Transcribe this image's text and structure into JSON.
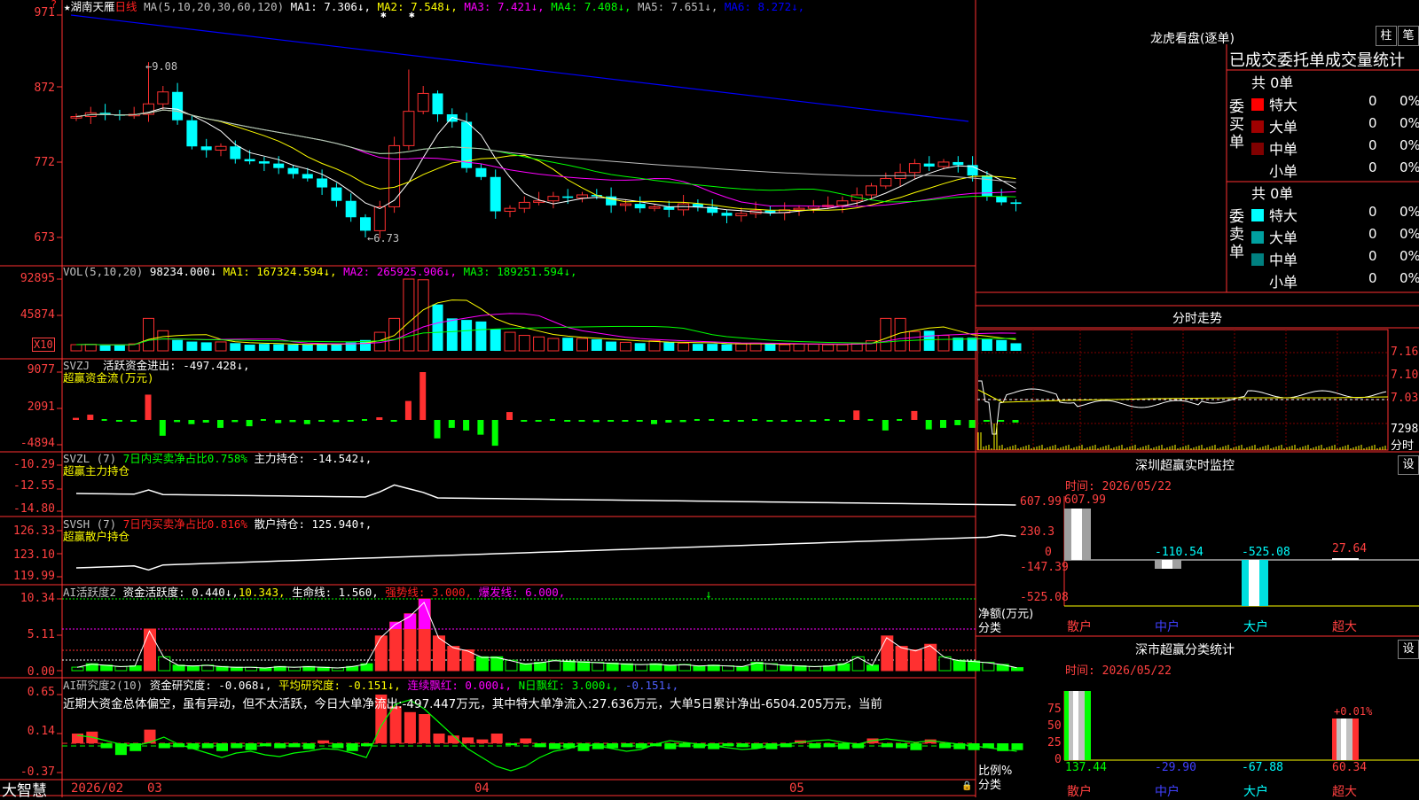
{
  "stock": {
    "name": "湖南天雁",
    "period": "日线",
    "star": "★"
  },
  "main_pane": {
    "ma_label": "MA(5,10,20,30,60,120)",
    "ma": [
      {
        "label": "MA1:",
        "value": "7.306↓",
        "color": "#ffffff"
      },
      {
        "label": "MA2:",
        "value": "7.548↓",
        "color": "#ffff00"
      },
      {
        "label": "MA3:",
        "value": "7.421↓",
        "color": "#ff00ff"
      },
      {
        "label": "MA4:",
        "value": "7.408↓",
        "color": "#00ff00"
      },
      {
        "label": "MA5:",
        "value": "7.651↓",
        "color": "#c0c0c0"
      },
      {
        "label": "MA6:",
        "value": "8.272↓",
        "color": "#0000ff"
      }
    ],
    "y_labels": [
      "971",
      "872",
      "772",
      "673"
    ],
    "high_mark": "9.08",
    "low_mark": "6.73"
  },
  "vol_pane": {
    "label": "VOL(5,10,20)",
    "value": "98234.000↓",
    "ma": [
      {
        "label": "MA1:",
        "value": "167324.594↓",
        "color": "#ffff00"
      },
      {
        "label": "MA2:",
        "value": "265925.906↓",
        "color": "#ff00ff"
      },
      {
        "label": "MA3:",
        "value": "189251.594↓",
        "color": "#00ff00"
      }
    ],
    "y_labels": [
      "92895",
      "45874"
    ],
    "unit": "X10"
  },
  "svzj_pane": {
    "label": "SVZJ",
    "field": "活跃资金进出:",
    "value": "-497.428↓,",
    "subtitle": "超赢资金流(万元)",
    "y_labels": [
      "9077",
      "2091",
      "-4894"
    ]
  },
  "svzl_pane": {
    "label": "SVZL (7)",
    "field1": "7日内买卖净占比0.758%",
    "field2": "主力持仓:",
    "value": "-14.542↓,",
    "subtitle": "超赢主力持仓",
    "y_labels": [
      "-10.29",
      "-12.55",
      "-14.80"
    ]
  },
  "svsh_pane": {
    "label": "SVSH (7)",
    "field1": "7日内买卖净占比0.816%",
    "field2": "散户持仓:",
    "value": "125.940↑,",
    "subtitle": "超赢散户持仓",
    "y_labels": [
      "126.33",
      "123.10",
      "119.99"
    ]
  },
  "active_pane": {
    "label": "AI活跃度2",
    "field1": "资金活跃度:",
    "value1": "0.440↓,",
    "value2": "10.343,",
    "field3": "生命线:",
    "value3": "1.560,",
    "field4": "强势线:",
    "value4": "3.000,",
    "field5": "爆发线:",
    "value5": "6.000,",
    "y_labels": [
      "10.34",
      "5.11",
      "0.00"
    ]
  },
  "research_pane": {
    "label": "AI研究度2(10)",
    "field1": "资金研究度:",
    "value1": "-0.068↓,",
    "field2": "平均研究度:",
    "value2": "-0.151↓,",
    "field3": "连续飘红:",
    "value3": "0.000↓,",
    "field4": "N日飘红:",
    "value4": "3.000↓,",
    "value5": "-0.151↓,",
    "comment": "近期大资金总体偏空，虽有异动，但不太活跃，今日大单净流出:-497.447万元，其中特大单净流入:27.636万元，大单5日累计净出-6504.205万元，当前",
    "y_labels": [
      "0.65",
      "0.14",
      "-0.37"
    ]
  },
  "x_axis": {
    "brand": "大智慧",
    "labels": [
      "2026/02",
      "03",
      "04",
      "05"
    ]
  },
  "dragon_tiger": {
    "title": "龙虎看盘(逐单)",
    "btn_bar": "柱",
    "btn_pen": "笔",
    "header": "已成交委托单成交量统计",
    "buy_side": {
      "side_label": "委买单",
      "total": "共 0单",
      "rows": [
        {
          "name": "特大",
          "count": "0",
          "pct": "0%",
          "color": "#ff0000"
        },
        {
          "name": "大单",
          "count": "0",
          "pct": "0%",
          "color": "#a00000"
        },
        {
          "name": "中单",
          "count": "0",
          "pct": "0%",
          "color": "#800000"
        },
        {
          "name": "小单",
          "count": "0",
          "pct": "0%",
          "color": ""
        }
      ]
    },
    "sell_side": {
      "side_label": "委卖单",
      "total": "共 0单",
      "rows": [
        {
          "name": "特大",
          "count": "0",
          "pct": "0%",
          "color": "#00ffff"
        },
        {
          "name": "大单",
          "count": "0",
          "pct": "0%",
          "color": "#00a0a0"
        },
        {
          "name": "中单",
          "count": "0",
          "pct": "0%",
          "color": "#008080"
        },
        {
          "name": "小单",
          "count": "0",
          "pct": "0%",
          "color": ""
        }
      ]
    }
  },
  "intraday": {
    "title": "分时走势",
    "prices": [
      "7.16",
      "7.10",
      "7.03"
    ],
    "volume": "7298",
    "unit": "分时"
  },
  "monitor": {
    "title": "深圳超赢实时监控",
    "btn": "设",
    "time": "时间: 2026/05/22",
    "y_labels": [
      "607.99",
      "230.3",
      "0",
      "-147.39",
      "-525.08"
    ],
    "y_caption": "净额(万元)",
    "x_caption": "分类",
    "categories": [
      "散户",
      "中户",
      "大户",
      "超大"
    ],
    "values": [
      "607.99",
      "-110.54",
      "-525.08",
      "27.64"
    ]
  },
  "classify": {
    "title": "深市超赢分类统计",
    "btn": "设",
    "time": "时间: 2026/05/22",
    "y_labels": [
      "75",
      "50",
      "25",
      "0"
    ],
    "y_caption": "比例%",
    "x_caption": "分类",
    "categories": [
      "散户",
      "中户",
      "大户",
      "超大"
    ],
    "values": [
      "137.44",
      "-29.90",
      "-67.88",
      "60.34"
    ],
    "annotation": "+0.01%"
  },
  "chart_data": [
    {
      "type": "candlestick",
      "title": "湖南天雁 日线",
      "ylim": [
        6.73,
        9.71
      ],
      "high": 9.08,
      "low": 6.73,
      "closes": [
        8.35,
        8.4,
        8.38,
        8.36,
        8.38,
        8.52,
        8.68,
        8.3,
        7.95,
        7.9,
        7.95,
        7.78,
        7.75,
        7.72,
        7.66,
        7.58,
        7.52,
        7.4,
        7.22,
        7.0,
        6.82,
        7.14,
        7.96,
        8.42,
        8.66,
        8.38,
        8.28,
        7.66,
        7.54,
        7.08,
        7.12,
        7.2,
        7.22,
        7.28,
        7.26,
        7.3,
        7.28,
        7.16,
        7.18,
        7.12,
        7.14,
        7.1,
        7.18,
        7.14,
        7.06,
        7.02,
        7.05,
        7.09,
        7.06,
        7.1,
        7.12,
        7.15,
        7.16,
        7.22,
        7.3,
        7.42,
        7.52,
        7.6,
        7.72,
        7.68,
        7.74,
        7.7,
        7.56,
        7.28,
        7.2,
        7.18
      ]
    },
    {
      "type": "bar",
      "title": "VOL(5,10,20)",
      "ylim": [
        0,
        92895
      ],
      "values": [
        8000,
        8500,
        7000,
        7500,
        9000,
        42000,
        26000,
        14000,
        12000,
        11000,
        11500,
        10000,
        8000,
        9000,
        8500,
        8000,
        8500,
        9000,
        8000,
        11000,
        14000,
        24000,
        42000,
        92895,
        92000,
        60000,
        42000,
        40000,
        38000,
        28000,
        24000,
        20000,
        18000,
        16000,
        17000,
        16000,
        15000,
        12000,
        11000,
        10000,
        13000,
        11000,
        10000,
        9000,
        9000,
        8500,
        9000,
        10000,
        9000,
        8000,
        9000,
        8500,
        8000,
        8000,
        10000,
        13000,
        42000,
        42000,
        25000,
        26000,
        20000,
        17000,
        17000,
        15000,
        14000,
        9823
      ]
    },
    {
      "type": "bar",
      "title": "超赢资金流(万元)",
      "ylim": [
        -4894,
        9077
      ],
      "values": [
        400,
        1000,
        0,
        -300,
        -200,
        4800,
        -3000,
        -400,
        -800,
        -500,
        -1500,
        -400,
        -1200,
        0,
        -600,
        -400,
        -800,
        -300,
        -400,
        -200,
        0,
        500,
        -300,
        3600,
        9077,
        -3500,
        -1500,
        -2000,
        -2800,
        -4894,
        1500,
        -300,
        -200,
        0,
        -300,
        -200,
        -400,
        -200,
        -200,
        -300,
        -800,
        -500,
        -400,
        0,
        0,
        -300,
        -200,
        0,
        -300,
        -200,
        -200,
        -300,
        0,
        -200,
        1800,
        0,
        -2000,
        0,
        1700,
        -1800,
        -1500,
        -1000,
        -1500,
        -200,
        -300,
        -497
      ]
    },
    {
      "type": "bar",
      "title": "AI活跃度2",
      "ylim": [
        0,
        10.34
      ],
      "values": [
        0.5,
        1.0,
        0.8,
        0.6,
        0.7,
        6.0,
        2.0,
        0.8,
        0.7,
        0.8,
        0.6,
        0.5,
        0.5,
        0.4,
        0.6,
        0.5,
        0.6,
        0.5,
        0.4,
        0.6,
        1.0,
        5.0,
        7.0,
        8.2,
        10.34,
        5.0,
        3.5,
        3.0,
        2.0,
        2.0,
        1.5,
        1.0,
        1.2,
        1.5,
        1.4,
        1.3,
        1.2,
        1.1,
        1.0,
        0.9,
        1.0,
        0.8,
        0.9,
        0.7,
        0.8,
        0.7,
        0.6,
        1.2,
        1.0,
        0.8,
        0.7,
        0.6,
        0.7,
        1.0,
        2.0,
        0.8,
        5.0,
        3.5,
        3.0,
        3.8,
        2.0,
        1.5,
        1.4,
        1.2,
        0.9,
        0.44
      ]
    }
  ]
}
